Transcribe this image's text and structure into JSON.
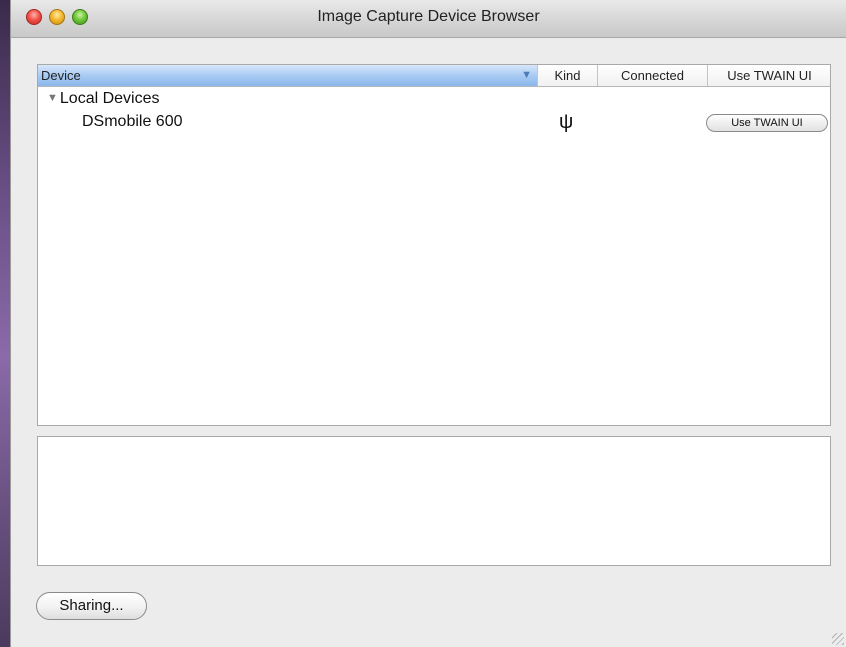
{
  "window": {
    "title": "Image Capture Device Browser"
  },
  "device_table": {
    "columns": {
      "device": "Device",
      "kind": "Kind",
      "connected": "Connected",
      "use_twain": "Use TWAIN UI"
    },
    "sort_icon": "sort-down-icon",
    "groups": [
      {
        "label": "Local Devices",
        "expanded": true,
        "devices": [
          {
            "name": "DSmobile 600",
            "kind_icon": "usb-icon",
            "kind_glyph": "ψ",
            "connected": "",
            "twain_button_label": "Use TWAIN UI"
          }
        ]
      }
    ]
  },
  "buttons": {
    "sharing_label": "Sharing..."
  }
}
